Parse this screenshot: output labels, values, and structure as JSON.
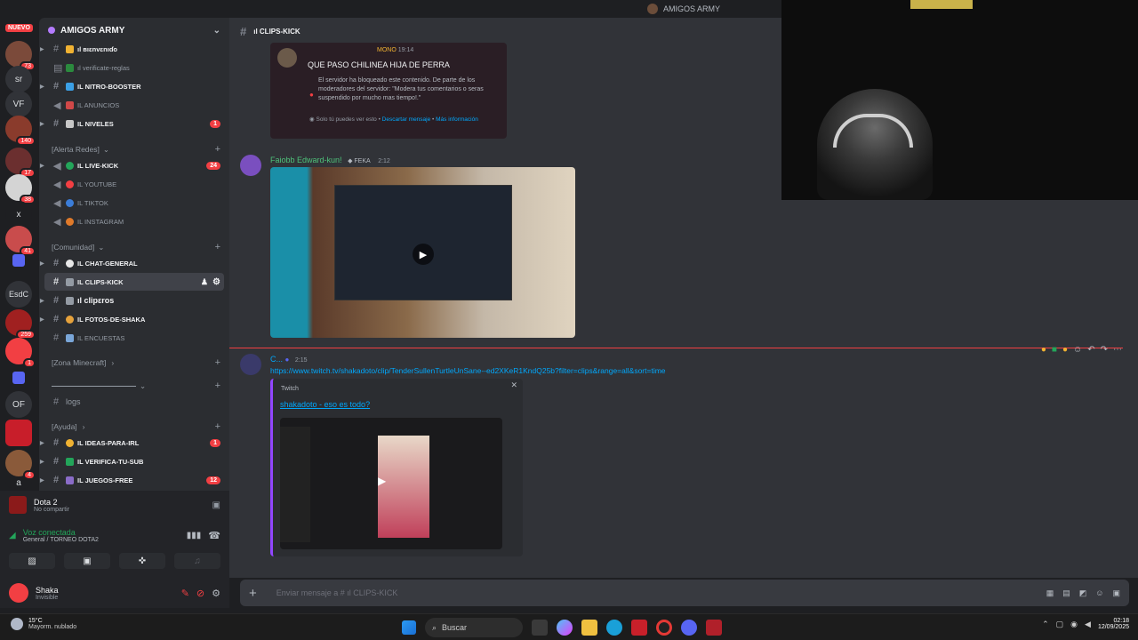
{
  "topbar": {
    "title": "AMIGOS ARMY"
  },
  "rail": {
    "nuevo": "NUEVO",
    "items": [
      {
        "label": "",
        "badge": "73"
      },
      {
        "label": "sr",
        "badge": ""
      },
      {
        "label": "VF",
        "badge": ""
      },
      {
        "label": "",
        "badge": "140"
      },
      {
        "label": "",
        "badge": "17"
      },
      {
        "label": "",
        "badge": "38"
      },
      {
        "label": "x",
        "badge": ""
      },
      {
        "label": "",
        "badge": "41"
      },
      {
        "label": "",
        "badge": ""
      },
      {
        "label": "EsdC",
        "badge": ""
      },
      {
        "label": "",
        "badge": "259"
      },
      {
        "label": "",
        "badge": "1"
      },
      {
        "label": "",
        "badge": ""
      },
      {
        "label": "OF",
        "badge": ""
      },
      {
        "label": "",
        "badge": ""
      },
      {
        "label": "",
        "badge": "4"
      },
      {
        "label": "a",
        "badge": ""
      }
    ]
  },
  "server": {
    "name": "AMIGOS ARMY"
  },
  "channels": {
    "c1": "ıl ʙıɛnvɛnıɗo",
    "c2": "ıl verificate-reglas",
    "c3": "ıl NITRO-BOOSTER",
    "c4": "ıl ANUNCIOS",
    "c5": "ıl NIVELES",
    "c5_count": "1",
    "cat_alerta": "[Alerta Redes]",
    "c6": "ıl LIVE-KICK",
    "c6_count": "24",
    "c7": "ıl YOUTUBE",
    "c8": "ıl TIKTOK",
    "c9": "ıl INSTAGRAM",
    "cat_comunidad": "[Comunidad]",
    "c10": "ıl CHAT-GENERAL",
    "c11": "ıl CLIPS-KICK",
    "c12": "ıl clipεros",
    "c13": "ıl FOTOS-DE-SHAKA",
    "c14": "ıl ENCUESTAS",
    "cat_minecraft": "[Zona Minecraft]",
    "cat_line": "",
    "c15": "logs",
    "cat_ayuda": "[Ayuda]",
    "c16": "ıl IDEAS-PARA-IRL",
    "c16_count": "1",
    "c17": "ıl VERIFICA-TU-SUB",
    "c18": "ıl JUEGOS-FREE",
    "c18_count": "12"
  },
  "panel": {
    "game": "Dota 2",
    "game_sub": "No compartir",
    "voice": "Voz conectada",
    "voice_sub": "General / TORNEO DOTA2",
    "user": "Shaka",
    "status": "Invisible"
  },
  "chat": {
    "header": "ıl CLIPS-KICK",
    "m1_title": "QUE PASO CHILINEA HIJA DE PERRA",
    "m1_tag": "MONO",
    "m1_time": "19:14",
    "m1_body": "El servidor ha bloqueado este contenido. De parte de los moderadores del servidor: \"Modera tus comentarios o seras suspendido por mucho mas tiempo!.\"",
    "m1_footer": "Solo tú puedes ver esto",
    "m1_dismiss": "Descartar mensaje",
    "m1_more": "Más información",
    "m2_author": "Faiobb Edward-kun!",
    "m2_tag": "FEKA",
    "m2_time": "2:12",
    "m3_author": "C...",
    "m3_time": "2:15",
    "m3_link": "https://www.twitch.tv/shakadoto/clip/TenderSullenTurtleUnSane--ed2XKeR1KndQ25b?filter=clips&range=all&sort=time",
    "embed_provider": "Twitch",
    "embed_title": "shakadoto - eso es todo?",
    "composer_placeholder": "Enviar mensaje a # ıl CLIPS-KICK"
  },
  "taskbar": {
    "temp": "15°C",
    "weather": "Mayorm. nublado",
    "search": "Buscar",
    "time": "02:18",
    "date": "12/09/2025"
  }
}
